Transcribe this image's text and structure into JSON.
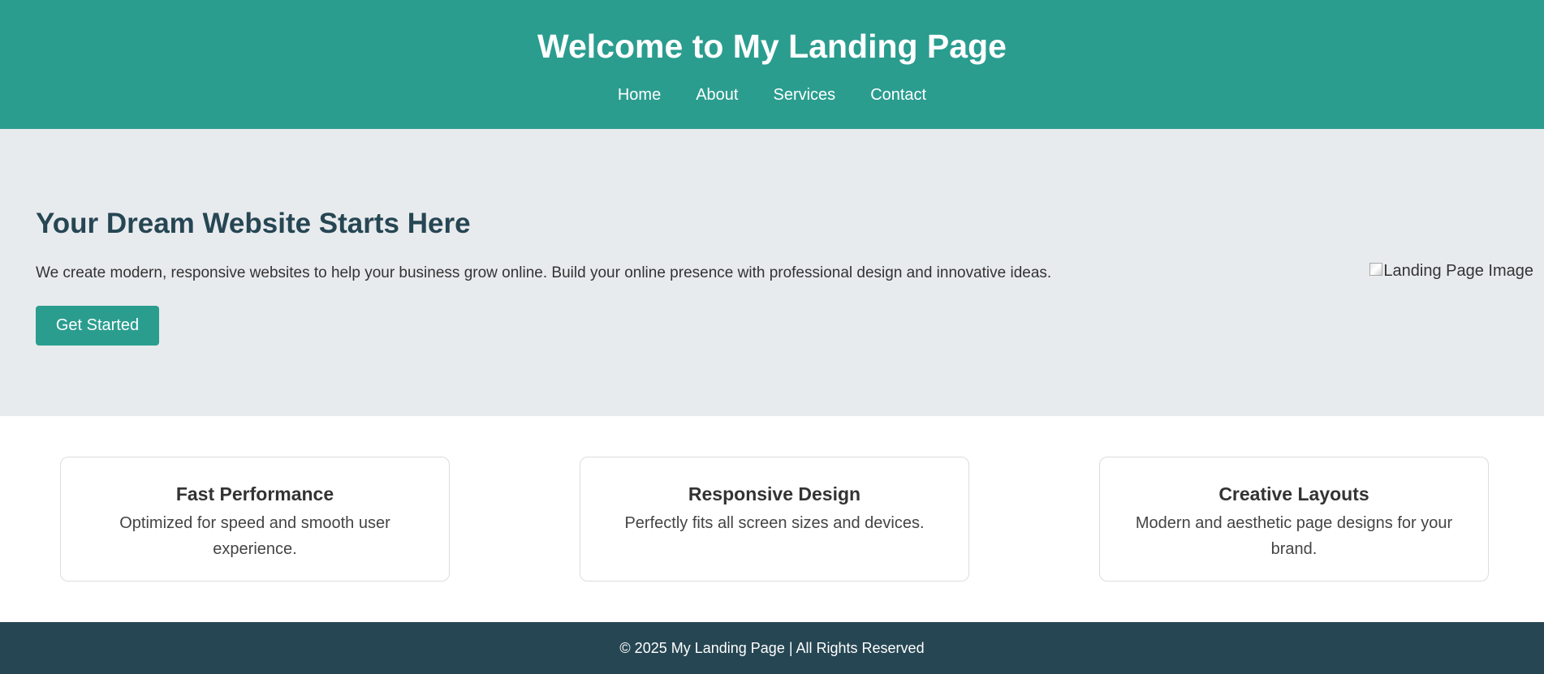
{
  "header": {
    "title": "Welcome to My Landing Page",
    "nav": [
      "Home",
      "About",
      "Services",
      "Contact"
    ]
  },
  "hero": {
    "title": "Your Dream Website Starts Here",
    "text": "We create modern, responsive websites to help your business grow online. Build your online presence with professional design and innovative ideas.",
    "button_label": "Get Started",
    "image_alt": "Landing Page Image"
  },
  "features": [
    {
      "title": "Fast Performance",
      "description": "Optimized for speed and smooth user experience."
    },
    {
      "title": "Responsive Design",
      "description": "Perfectly fits all screen sizes and devices."
    },
    {
      "title": "Creative Layouts",
      "description": "Modern and aesthetic page designs for your brand."
    }
  ],
  "footer": {
    "text": "© 2025 My Landing Page | All Rights Reserved"
  },
  "colors": {
    "primary": "#2a9d8f",
    "dark": "#264653",
    "hero_bg": "#e8ebee"
  },
  "icons": {
    "hero_image": "broken-image-icon"
  }
}
